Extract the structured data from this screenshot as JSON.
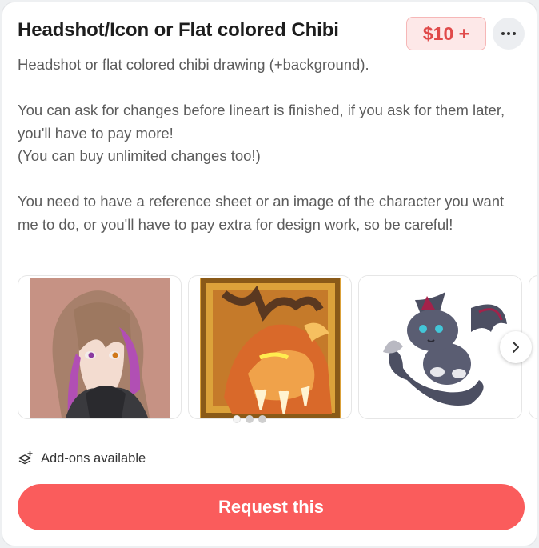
{
  "commission": {
    "title": "Headshot/Icon or Flat colored Chibi",
    "price": "$10 +",
    "description": "Headshot or flat colored chibi drawing (+background).\n\nYou can ask for changes before lineart is finished, if you ask for them later, you'll have to pay more!\n(You can buy unlimited changes too!)\n\nYou need to have a reference sheet or an image of the character you want me to do, or you'll have to pay extra for design work, so be careful!"
  },
  "gallery": {
    "images": [
      {
        "name": "character-headshot-purple-hair",
        "icon": "image"
      },
      {
        "name": "dragon-headshot-gold-frame",
        "icon": "image"
      },
      {
        "name": "chibi-winged-cat-dragon",
        "icon": "image"
      }
    ],
    "next_icon": "chevron-right-icon",
    "page_count": 3,
    "active_page": 1
  },
  "addons": {
    "label": "Add-ons available",
    "icon": "layers-plus-icon"
  },
  "actions": {
    "request_label": "Request this",
    "more_icon": "more-horizontal-icon"
  },
  "colors": {
    "accent": "#fa5c5c",
    "price_text": "#e04a4a",
    "price_bg": "#fde8e8"
  }
}
